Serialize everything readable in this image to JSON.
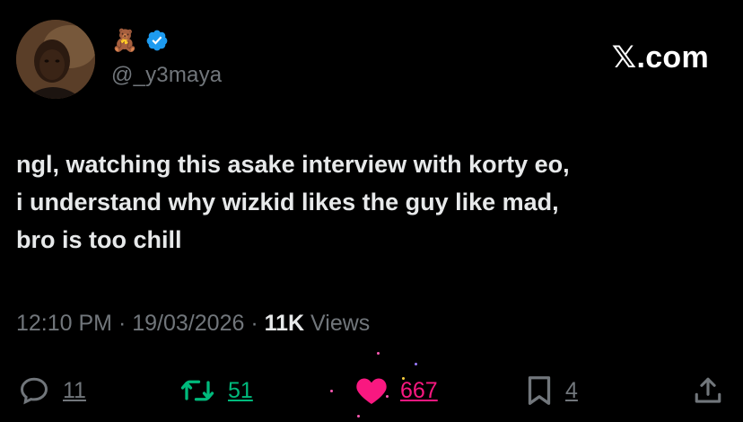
{
  "user": {
    "emoji": "🧸",
    "handle": "@_y3maya"
  },
  "site_label": "𝕏.com",
  "tweet": {
    "text": "ngl, watching this asake interview with korty eo,\ni understand why wizkid likes the guy like mad,\nbro is too chill"
  },
  "meta": {
    "time": "12:10 PM",
    "date": "19/03/2026",
    "views_count": "11K",
    "views_label": "Views",
    "separator": "·"
  },
  "actions": {
    "replies": "11",
    "reposts": "51",
    "likes": "667",
    "bookmarks": "4"
  },
  "colors": {
    "background": "#000000",
    "text": "#e7e9ea",
    "muted": "#71767b",
    "verified": "#1d9bf0",
    "repost": "#00ba7c",
    "like": "#f91880"
  },
  "icons": [
    "verified-badge-icon",
    "reply-icon",
    "repost-icon",
    "heart-icon",
    "bookmark-icon",
    "share-icon"
  ]
}
